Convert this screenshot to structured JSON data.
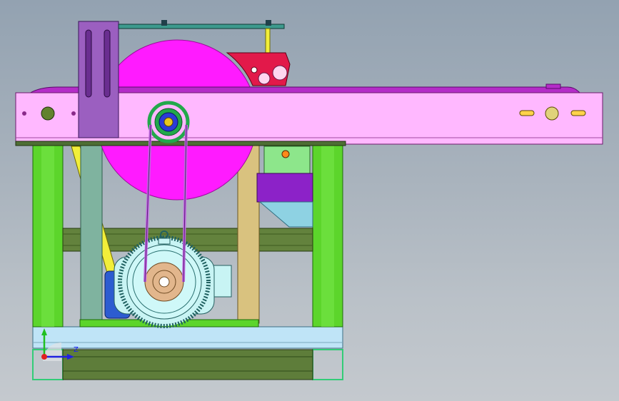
{
  "viewport": {
    "background_top": "#93a2b1",
    "background_bottom": "#c4c9ce"
  },
  "colors": {
    "base_rail": "#bfe4f7",
    "base_rail_dark": "#9dc8dc",
    "bottom_frame": "#5e7d3a",
    "leg_green": "#5cd52b",
    "leg_green_dark": "#2f8f13",
    "cross_beam": "#63823d",
    "post_teal": "#7fb39f",
    "post_tan": "#d9c27f",
    "saw_blade": "#ff1bff",
    "top_beam": "#ffb8ff",
    "top_beam_top": "#b42cc8",
    "bracket": "#9b5fc0",
    "motor_body": "#c8f4f4",
    "motor_pulley": "#e2b68c",
    "belt": "#c06adf",
    "pulley_ring": "#22a84b",
    "pulley_core": "#2b3bd8",
    "pulley_center": "#e8c81c",
    "guard_red": "#e2194a",
    "yellow_strut": "#f2ee3a",
    "motor_mount_purple": "#8c22c8",
    "motor_mount_blue": "#8ed2e3",
    "bracket_green": "#8de68b",
    "coupling_blue": "#2d5cd0",
    "axis_x": "#e02020",
    "axis_y": "#20c020",
    "axis_z": "#2020e0"
  },
  "triad": {
    "axis_label": "Z"
  },
  "icons": [
    "coordinate-triad-icon"
  ]
}
